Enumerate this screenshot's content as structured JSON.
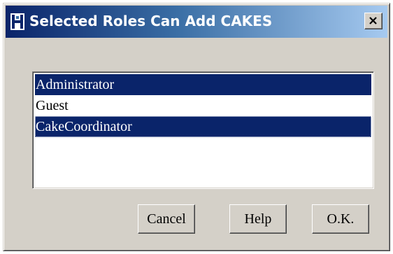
{
  "window": {
    "title": "Selected Roles Can Add CAKES",
    "close_glyph": "✕"
  },
  "roles_list": {
    "items": [
      {
        "label": "Administrator",
        "selected": true
      },
      {
        "label": "Guest",
        "selected": false
      },
      {
        "label": "CakeCoordinator",
        "selected": true
      }
    ]
  },
  "buttons": {
    "cancel_label": "Cancel",
    "help_label": "Help",
    "ok_label": "O.K."
  },
  "colors": {
    "selection": "#0a246a",
    "face": "#d4d0c8",
    "title_gradient_start": "#0a246a",
    "title_gradient_end": "#a6caf0"
  },
  "icons": {
    "app": "app-icon",
    "close": "close-icon"
  }
}
